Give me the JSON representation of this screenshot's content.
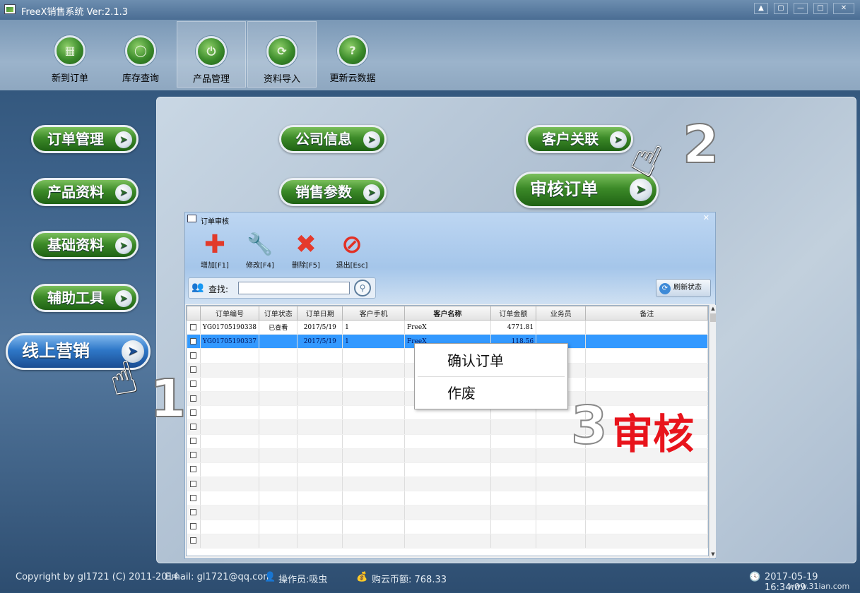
{
  "app": {
    "title": "FreeX销售系统 Ver:2.1.3"
  },
  "toolbar": [
    {
      "label": "新到订单",
      "icon": "grid-icon"
    },
    {
      "label": "库存查询",
      "icon": "search-icon"
    },
    {
      "label": "产品管理",
      "icon": "power-icon"
    },
    {
      "label": "资料导入",
      "icon": "refresh-icon"
    },
    {
      "label": "更新云数据",
      "icon": "help-icon"
    }
  ],
  "sidebar": {
    "items": [
      {
        "label": "订单管理"
      },
      {
        "label": "产品资料"
      },
      {
        "label": "基础资料"
      },
      {
        "label": "辅助工具"
      },
      {
        "label": "线上营销"
      }
    ]
  },
  "panel": {
    "buttons": [
      {
        "label": "公司信息"
      },
      {
        "label": "销售参数"
      },
      {
        "label": "客户关联"
      },
      {
        "label": "审核订单"
      }
    ]
  },
  "dialog": {
    "title": "订单审核",
    "tools": [
      {
        "label": "增加[F1]",
        "icon": "plus-icon",
        "color": "#e23a2a"
      },
      {
        "label": "修改[F4]",
        "icon": "wrench-icon",
        "color": "#d9332b"
      },
      {
        "label": "删除[F5]",
        "icon": "x-icon",
        "color": "#e53a2c"
      },
      {
        "label": "退出[Esc]",
        "icon": "no-entry-icon",
        "color": "#e23024"
      }
    ],
    "search_label": "查找:",
    "search_value": "",
    "refresh_label": "刷新状态",
    "columns": [
      "订单编号",
      "订单状态",
      "订单日期",
      "客户手机",
      "客户名称",
      "订单金额",
      "业务员",
      "备注"
    ],
    "rows": [
      [
        "YG01705190338",
        "已查看",
        "2017/5/19",
        "1",
        "FreeX",
        "4771.81",
        "",
        ""
      ],
      [
        "YG01705190337",
        "",
        "2017/5/19",
        "1",
        "FreeX",
        "118.56",
        "",
        ""
      ]
    ],
    "selected_row": 1
  },
  "context_menu": {
    "items": [
      "确认订单",
      "作废"
    ]
  },
  "annotations": {
    "step1": "1",
    "step2": "2",
    "step3": "3",
    "step3_text": "审核"
  },
  "status": {
    "copyright": "Copyright by gl1721 (C) 2011-2014",
    "email": "Email: gl1721@qq.com",
    "operator": "操作员:吸虫",
    "balance": "购云币额: 768.33",
    "datetime": "2017-05-19 16:34:09",
    "watermark": "www.31ian.com"
  },
  "colors": {
    "accent_green": "#3c8a28",
    "accent_blue": "#2f78c8",
    "selection": "#3399ff",
    "step_red": "#e8141c"
  }
}
